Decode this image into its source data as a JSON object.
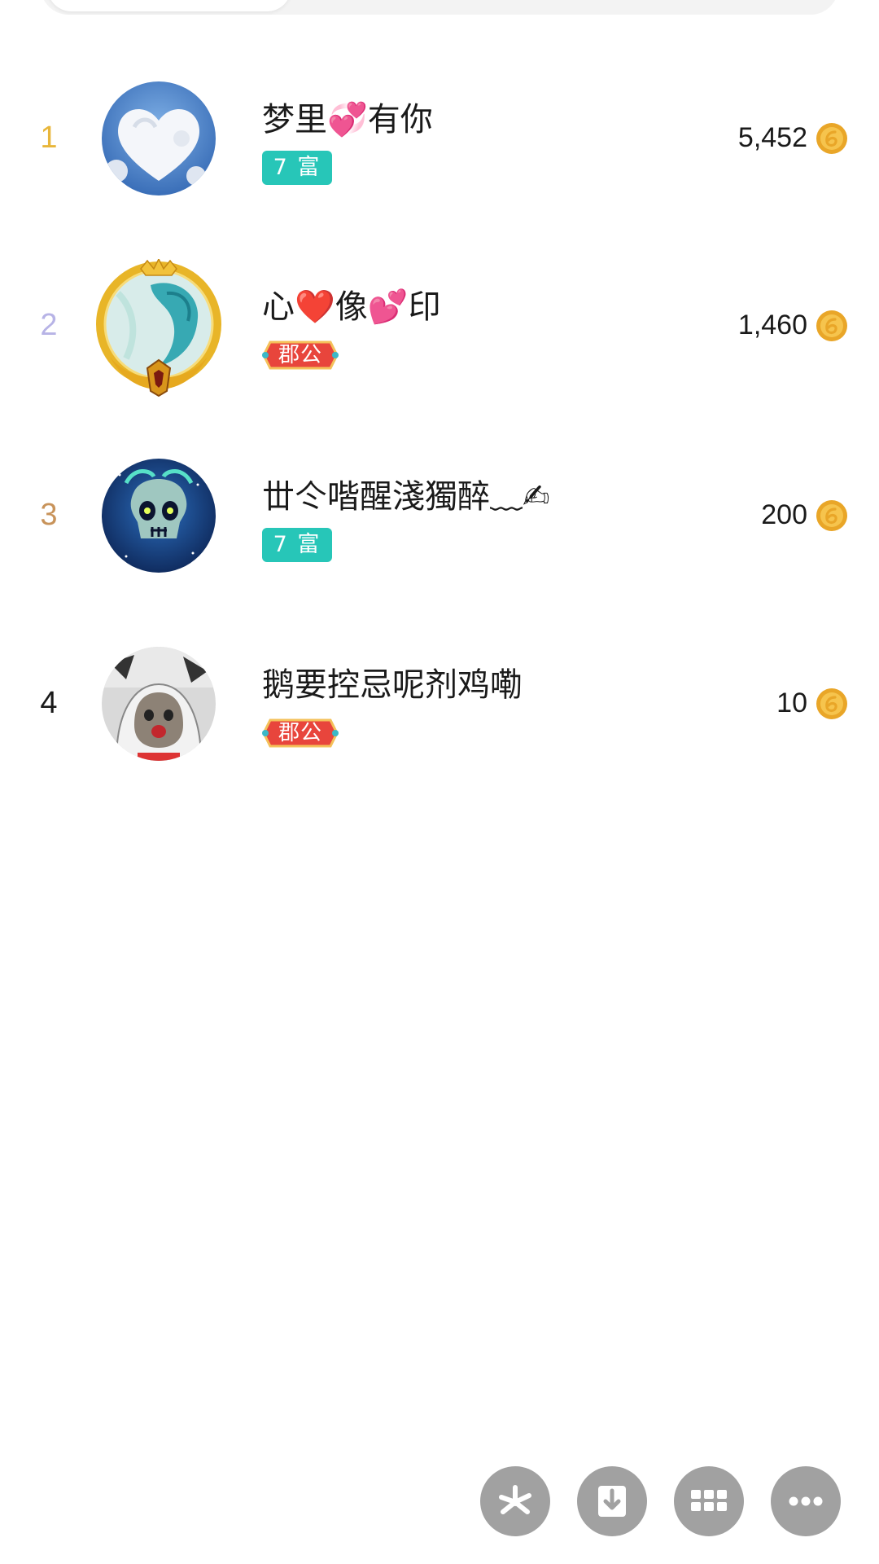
{
  "rank_list": [
    {
      "rank": "1",
      "name": "梦里💞有你",
      "badge_type": "rich",
      "badge": "7 富",
      "coins": "5,452",
      "rank_color": "#e8b63a"
    },
    {
      "rank": "2",
      "name": "心❤️像💕印",
      "badge_type": "duke",
      "badge": "郡公",
      "coins": "1,460",
      "rank_color": "#b7b3e6"
    },
    {
      "rank": "3",
      "name": "丗仒喈醒淺獨醉﹏✍",
      "badge_type": "rich",
      "badge": "7 富",
      "coins": "200",
      "rank_color": "#c8935a"
    },
    {
      "rank": "4",
      "name": "鹅要控忌呢剂鸡嘞",
      "badge_type": "duke",
      "badge": "郡公",
      "coins": "10",
      "rank_color": "#1a1a1a"
    }
  ],
  "icons": {
    "coin": "coin-icon",
    "fab_1": "pinwheel-icon",
    "fab_2": "download-icon",
    "fab_3": "grid-icon",
    "fab_4": "more-icon"
  },
  "colors": {
    "rich_badge": "#27c6b8",
    "duke_badge": "#e8453c",
    "coin": "#e9a628",
    "fab": "#a1a1a1"
  }
}
